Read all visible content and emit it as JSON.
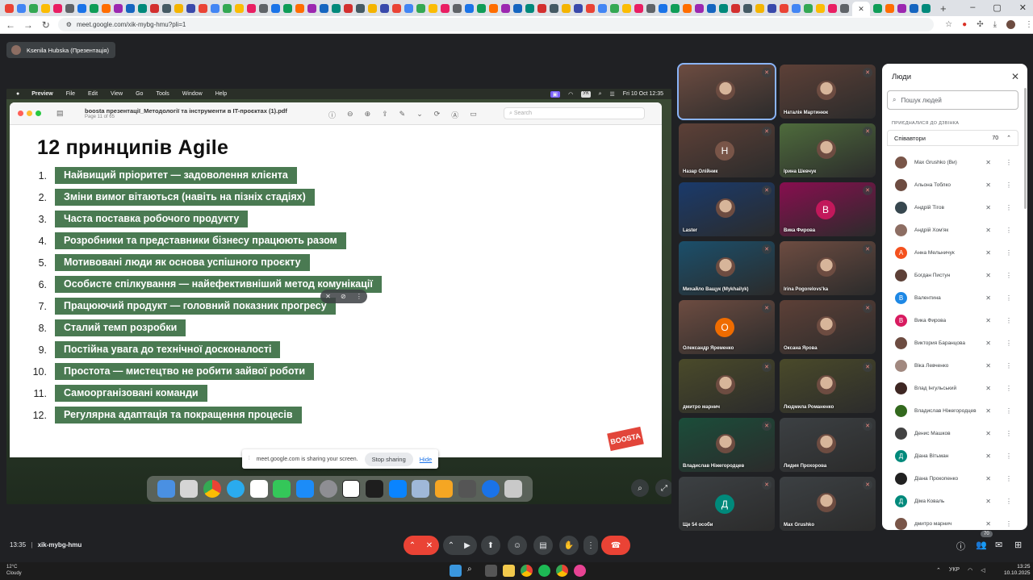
{
  "browser": {
    "url": "meet.google.com/xik-mybg-hmu?pli=1",
    "tab_add": "+",
    "win_controls": [
      "–",
      "▢",
      "✕"
    ]
  },
  "meet": {
    "presenter_chip": "Ksenila Hubska (Презентація)",
    "time": "13:35",
    "meeting_code": "xik-mybg-hmu",
    "people_badge": "70"
  },
  "mac": {
    "menu": [
      "Preview",
      "File",
      "Edit",
      "View",
      "Go",
      "Tools",
      "Window",
      "Help"
    ],
    "status_date": "Fri 10 Oct  12:35",
    "status_vk": "УК"
  },
  "pdf": {
    "title": "boosta презентації_Методології та інструменти в IT-проєктах (1).pdf",
    "subtitle": "Page 11 of 65",
    "search_placeholder": "Search"
  },
  "slide": {
    "heading": "12 принципів Agile",
    "brand": "BOOSTA",
    "principles": [
      {
        "n": "1.",
        "t": "Найвищий пріоритет — задоволення клієнта"
      },
      {
        "n": "2.",
        "t": "Зміни вимог вітаються (навіть на пізніх стадіях)"
      },
      {
        "n": "3.",
        "t": "Часта поставка робочого продукту"
      },
      {
        "n": "4.",
        "t": "Розробники та представники бізнесу працюють разом"
      },
      {
        "n": "5.",
        "t": "Мотивовані люди як основа успішного проєкту"
      },
      {
        "n": "6.",
        "t": "Особисте спілкування — найефективніший метод комунікації"
      },
      {
        "n": "7.",
        "t": "Працюючий продукт — головний показник прогресу"
      },
      {
        "n": "8.",
        "t": "Сталий темп розробки"
      },
      {
        "n": "9.",
        "t": "Постійна увага до технічної досконалості"
      },
      {
        "n": "10.",
        "t": "Простота — мистецтво не робити зайвої роботи"
      },
      {
        "n": "11.",
        "t": "Самоорганізовані команди"
      },
      {
        "n": "12.",
        "t": "Регулярна адаптація та покращення процесів"
      }
    ]
  },
  "sharebar": {
    "text": "meet.google.com is sharing your screen.",
    "stop": "Stop sharing",
    "hide": "Hide"
  },
  "tiles": [
    {
      "name": "",
      "initial": "",
      "color": "#6d4c41"
    },
    {
      "name": "Наталія Мартинюк",
      "initial": "",
      "color": "#5d4037"
    },
    {
      "name": "Назар Олійник",
      "initial": "Н",
      "color": "#5d4037",
      "avatar": "#795548"
    },
    {
      "name": "Ірина Шевчук",
      "initial": "",
      "color": "#4e6b3c"
    },
    {
      "name": "Laster",
      "initial": "",
      "color": "#1a3a6b"
    },
    {
      "name": "Вика Фирова",
      "initial": "В",
      "color": "#880e4f",
      "avatar": "#c2185b"
    },
    {
      "name": "Михайло Ващук (Mykhailyk)",
      "initial": "",
      "color": "#1b4f6b"
    },
    {
      "name": "Irina Pogorelovs'ka",
      "initial": "",
      "color": "#6d4c41"
    },
    {
      "name": "Олександр Яременко",
      "initial": "О",
      "color": "#6d4c41",
      "avatar": "#ef6c00"
    },
    {
      "name": "Оксана Ярова",
      "initial": "",
      "color": "#5d4037"
    },
    {
      "name": "дмитро марнич",
      "initial": "",
      "color": "#4a4a2a"
    },
    {
      "name": "Людмила Романенко",
      "initial": "",
      "color": "#4a4a2a"
    },
    {
      "name": "Владислав Ніжегородцев",
      "initial": "",
      "color": "#1b4d3a"
    },
    {
      "name": "Лидия Прохорова",
      "initial": "",
      "color": "#3c4043"
    },
    {
      "name": "Ще 54 особи",
      "initial": "Д",
      "color": "#3c4043",
      "avatar": "#00897b"
    },
    {
      "name": "Max Grushko",
      "initial": "",
      "color": "#3c4043"
    }
  ],
  "people_panel": {
    "title": "Люди",
    "search_placeholder": "Пошук людей",
    "joined_label": "Приєдналися до дзвінка",
    "section": "Співавтори",
    "count": "70",
    "list": [
      {
        "name": "Max Grushko (Ви)",
        "initial": "",
        "color": "#795548"
      },
      {
        "name": "Альона Тоблко",
        "initial": "",
        "color": "#6d4c41"
      },
      {
        "name": "Андрій Тігов",
        "initial": "",
        "color": "#37474f"
      },
      {
        "name": "Андрій Хом'як",
        "initial": "",
        "color": "#8d6e63"
      },
      {
        "name": "Анна Мельничук",
        "initial": "А",
        "color": "#f4511e"
      },
      {
        "name": "Богдан Пистун",
        "initial": "",
        "color": "#5d4037"
      },
      {
        "name": "Валентина",
        "initial": "В",
        "color": "#1e88e5"
      },
      {
        "name": "Вика Фирова",
        "initial": "В",
        "color": "#d81b60"
      },
      {
        "name": "Виктория Баранцова",
        "initial": "",
        "color": "#6d4c41"
      },
      {
        "name": "Віка Левченко",
        "initial": "",
        "color": "#a1887f"
      },
      {
        "name": "Влад Інгульський",
        "initial": "",
        "color": "#3e2723"
      },
      {
        "name": "Владислав Ніжегородцев",
        "initial": "",
        "color": "#33691e"
      },
      {
        "name": "Денис Машков",
        "initial": "",
        "color": "#424242"
      },
      {
        "name": "Діана Вітьман",
        "initial": "Д",
        "color": "#00897b"
      },
      {
        "name": "Діана Прокопенко",
        "initial": "",
        "color": "#212121"
      },
      {
        "name": "Діма Коваль",
        "initial": "Д",
        "color": "#00897b"
      },
      {
        "name": "дмитро марнич",
        "initial": "",
        "color": "#795548"
      }
    ]
  },
  "taskbar": {
    "weather_temp": "12°C",
    "weather_desc": "Cloudy",
    "lang": "УКР",
    "clock_time": "13:25",
    "clock_date": "10.10.2025"
  }
}
